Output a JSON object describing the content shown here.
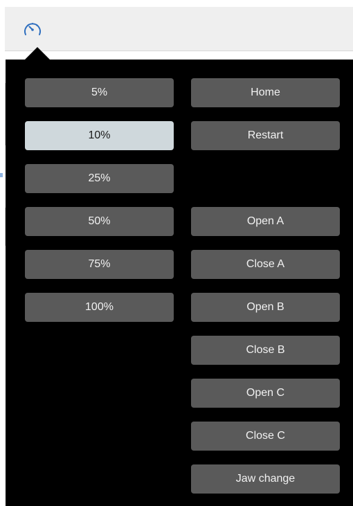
{
  "toolbar": {
    "icon": "speedometer-icon",
    "accent_color": "#2f6fbf"
  },
  "speed_buttons": [
    {
      "label": "5%",
      "active": false
    },
    {
      "label": "10%",
      "active": true
    },
    {
      "label": "25%",
      "active": false
    },
    {
      "label": "50%",
      "active": false
    },
    {
      "label": "75%",
      "active": false
    },
    {
      "label": "100%",
      "active": false
    }
  ],
  "action_buttons": [
    {
      "label": "Home"
    },
    {
      "label": "Restart"
    },
    {
      "label": "Open A"
    },
    {
      "label": "Close A"
    },
    {
      "label": "Open B"
    },
    {
      "label": "Close B"
    },
    {
      "label": "Open C"
    },
    {
      "label": "Close C"
    },
    {
      "label": "Jaw change"
    }
  ],
  "colors": {
    "panel": "#000000",
    "button": "#5a5a5a",
    "button_active": "#cfd8dc",
    "button_text": "#f2f2f2"
  }
}
